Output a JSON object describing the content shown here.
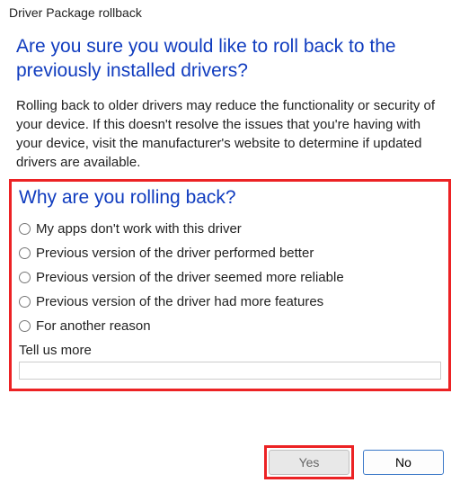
{
  "window": {
    "title": "Driver Package rollback"
  },
  "heading": "Are you sure you would like to roll back to the previously installed drivers?",
  "body": "Rolling back to older drivers may reduce the functionality or security of your device. If this doesn't resolve the issues that you're having with your device, visit the manufacturer's website to determine if updated drivers are available.",
  "section_heading": "Why are you rolling back?",
  "reasons": [
    "My apps don't work with this driver",
    "Previous version of the driver performed better",
    "Previous version of the driver seemed more reliable",
    "Previous version of the driver had more features",
    "For another reason"
  ],
  "tell_us_more_label": "Tell us more",
  "tell_us_more_value": "",
  "buttons": {
    "yes": "Yes",
    "no": "No"
  },
  "highlight_color": "#ec2224"
}
